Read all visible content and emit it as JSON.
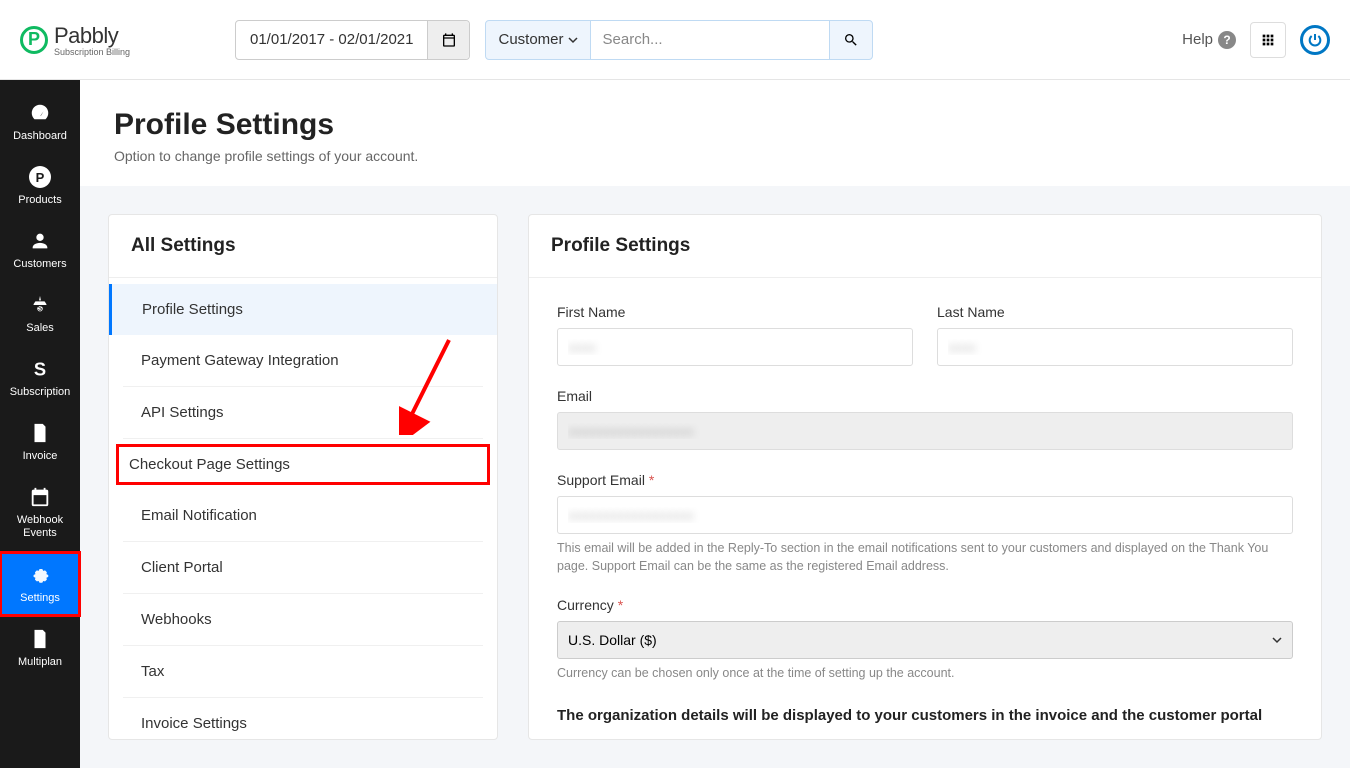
{
  "brand": {
    "name": "Pabbly",
    "sub": "Subscription Billing"
  },
  "topbar": {
    "date_range": "01/01/2017 - 02/01/2021",
    "search_dd": "Customer",
    "search_placeholder": "Search...",
    "help": "Help"
  },
  "sidebar": {
    "items": [
      {
        "label": "Dashboard"
      },
      {
        "label": "Products"
      },
      {
        "label": "Customers"
      },
      {
        "label": "Sales"
      },
      {
        "label": "Subscription"
      },
      {
        "label": "Invoice"
      },
      {
        "label": "Webhook Events"
      },
      {
        "label": "Settings"
      },
      {
        "label": "Multiplan"
      }
    ]
  },
  "page": {
    "title": "Profile Settings",
    "subtitle": "Option to change profile settings of your account."
  },
  "left_panel": {
    "title": "All Settings",
    "items": [
      "Profile Settings",
      "Payment Gateway Integration",
      "API Settings",
      "Checkout Page Settings",
      "Email Notification",
      "Client Portal",
      "Webhooks",
      "Tax",
      "Invoice Settings"
    ]
  },
  "right_panel": {
    "title": "Profile Settings",
    "labels": {
      "first_name": "First Name",
      "last_name": "Last Name",
      "email": "Email",
      "support_email": "Support Email",
      "currency": "Currency"
    },
    "values": {
      "first_name": "",
      "last_name": "",
      "email": "",
      "support_email": "",
      "currency": "U.S. Dollar ($)"
    },
    "support_hint": "This email will be added in the Reply-To section in the email notifications sent to your customers and displayed on the Thank You page. Support Email can be the same as the registered Email address.",
    "currency_hint": "Currency can be chosen only once at the time of setting up the account.",
    "org_note": "The organization details will be displayed to your customers in the invoice and the customer portal"
  }
}
